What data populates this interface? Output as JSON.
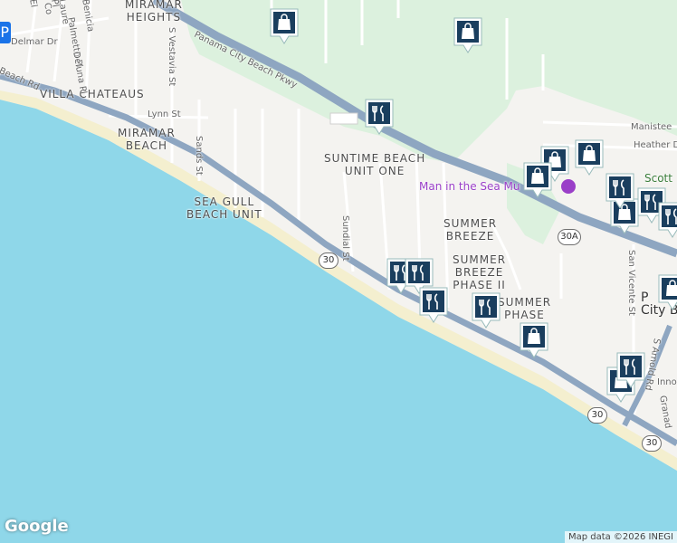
{
  "map": {
    "colors": {
      "water": "#8fd7e9",
      "land": "#f4f3f0",
      "park": "#dcf1de",
      "highway": "#8ea6c1",
      "beach": "#f4efcf",
      "pin": "#1a3e5e"
    },
    "google_logo": "Google",
    "attribution": "Map data ©2026 INEGI"
  },
  "labels": {
    "miramar_heights": "MIRAMAR\nHEIGHTS",
    "villa_chateaus": "VILLA CHATEAUS",
    "miramar_beach": "MIRAMAR\nBEACH",
    "sea_gull": "SEA GULL\nBEACH UNIT",
    "suntime": "SUNTIME BEACH\nUNIT ONE",
    "summer_breeze": "SUMMER\nBREEZE",
    "summer_breeze_2": "SUMMER\nBREEZE\nPHASE II",
    "summer_breeze_3": "SUMMER\nPHASE",
    "pcb_partial": "P\nCity B",
    "man_in_the_sea": "Man in the Sea Mu",
    "scott": "Scott",
    "manistee": "Manistee",
    "heather": "Heather D"
  },
  "streets": {
    "pcb_pkwy": "Panama City Beach Pkwy",
    "beach_rd": "Beach Rd",
    "delmar": "Delmar Dr",
    "palmetto": "Palmetto Pl",
    "deluna": "Deluna Pl",
    "lynn": "Lynn St",
    "vestavia": "S Vestavia St",
    "sands": "Sands St",
    "sundial": "Sundial St",
    "san_vicente": "San Vicente St",
    "arnold": "S Arnold Rd",
    "inno": "Inno",
    "grana": "Granad",
    "laure": "Laure",
    "benicia": "Benicia",
    "corr": "Co",
    "pl": "Pl",
    "el": "El"
  },
  "shields": {
    "s1": "30",
    "s2": "30A",
    "s3": "30",
    "s4": "30"
  }
}
